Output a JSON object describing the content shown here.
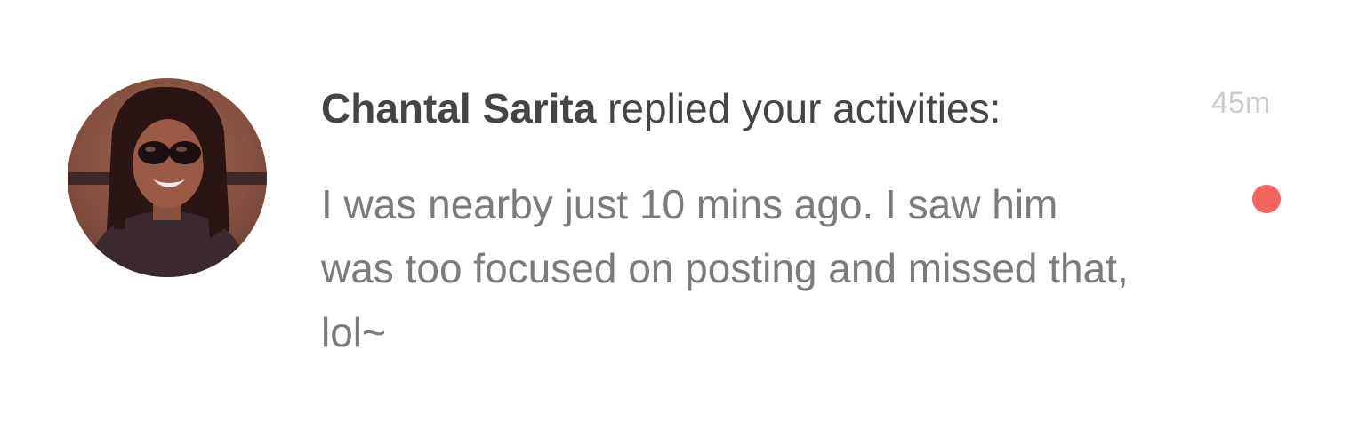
{
  "notification": {
    "sender_name": "Chantal Sarita",
    "action_text": "replied your activities:",
    "timestamp": "45m",
    "message": "I was nearby just 10 mins ago. I saw him was too focused on posting and missed that, lol~",
    "unread": true,
    "avatar_alt": "avatar"
  },
  "colors": {
    "unread_dot": "#f4645f",
    "name_text": "#444444",
    "message_text": "#7b7b7b",
    "timestamp_text": "#cccccc"
  }
}
